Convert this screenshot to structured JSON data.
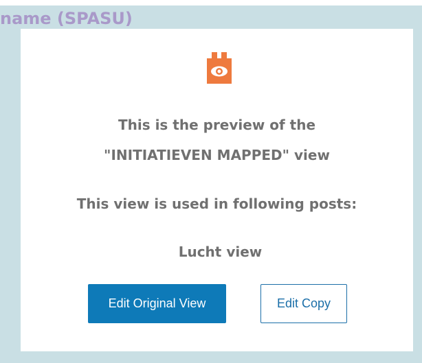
{
  "frame": {
    "title": "name (SPASU)"
  },
  "preview": {
    "icon": "eye-icon",
    "accent_color": "#ee7a3e",
    "line1": "This is the preview of the",
    "line2": "\"INITIATIEVEN MAPPED\" view",
    "used_in_label": "This view is used in following posts:",
    "posts": [
      "Lucht view"
    ]
  },
  "buttons": {
    "edit_original": "Edit Original View",
    "edit_copy": "Edit Copy"
  },
  "colors": {
    "background": "#c9dfe4",
    "primary_button": "#0e7ab8",
    "text_gray": "#707070",
    "title_purple": "#a999c9"
  }
}
